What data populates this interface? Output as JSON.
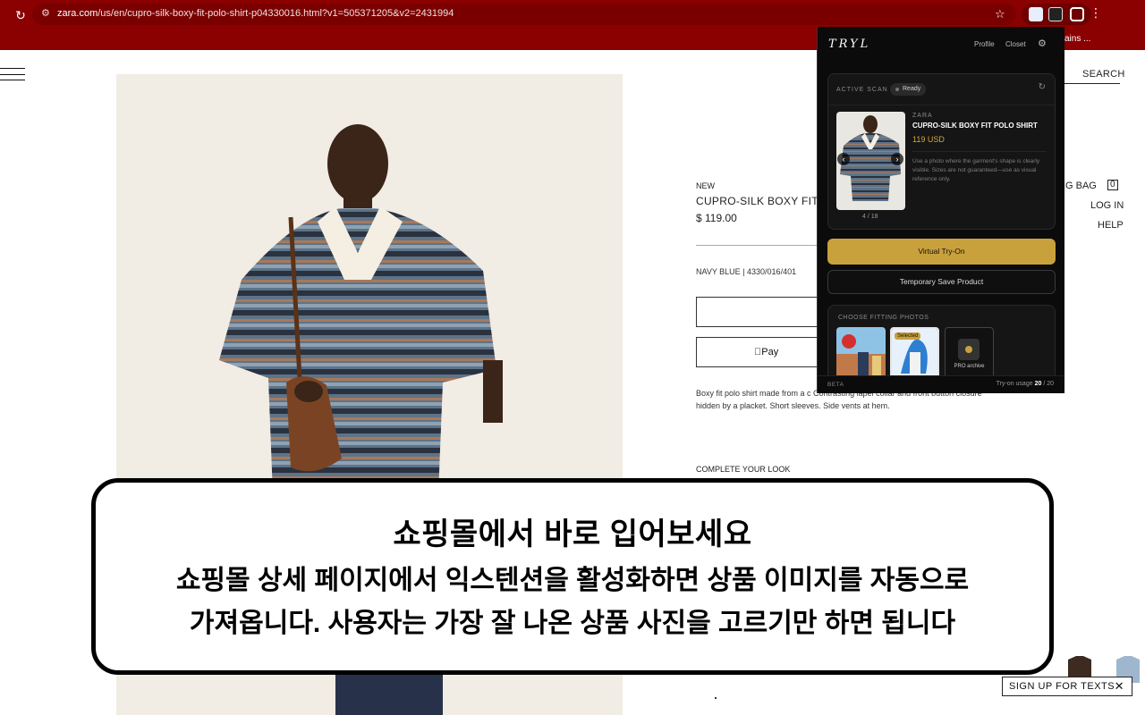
{
  "browser": {
    "url_host": "zara.com",
    "url_rest": "/us/en/cupro-silk-boxy-fit-polo-shirt-p04330016.html?v1=505371205&v2=2431994",
    "bookmark_text": "ains ..."
  },
  "zara": {
    "search_label": "SEARCH",
    "tag_new": "NEW",
    "product_name": "CUPRO-SILK BOXY FIT",
    "price": "$ 119.00",
    "color_ref": "NAVY BLUE | 4330/016/401",
    "apple_pay_label": "Pay",
    "description": "Boxy fit polo shirt made from a c Contrasting lapel collar and front button closure hidden by a placket. Short sleeves. Side vents at hem.",
    "complete_look": "COMPLETE YOUR LOOK",
    "shopping_bag": "ING BAG",
    "bag_count": "0",
    "login": "LOG IN",
    "help": "HELP",
    "signup": "SIGN UP FOR TEXTS"
  },
  "tryl": {
    "logo": "TRYL",
    "nav_profile": "Profile",
    "nav_closet": "Closet",
    "scan_label": "ACTIVE SCAN",
    "status": "Ready",
    "brand": "ZARA",
    "product_title": "CUPRO-SILK BOXY FIT POLO SHIRT",
    "price": "119 USD",
    "note": "Use a photo where the garment's shape is clearly visible. Sizes are not guaranteed—use as visual reference only.",
    "counter": "4 / 18",
    "tryon_label": "Virtual Try-On",
    "save_label": "Temporary Save Product",
    "fitting_label": "CHOOSE FITTING PHOTOS",
    "selected_badge": "Selected",
    "pro_label": "PRO archive",
    "beta": "BETA",
    "usage_label": "Try-on usage",
    "usage_used": "20",
    "usage_total": "/ 20"
  },
  "caption": {
    "title": "쇼핑몰에서 바로 입어보세요",
    "line1": "쇼핑몰 상세 페이지에서 익스텐션을 활성화하면 상품 이미지를 자동으로",
    "line2": "가져옵니다. 사용자는 가장 잘 나온 상품 사진을 고르기만 하면 됩니다"
  },
  "colors": {
    "chrome_bg": "#8b0000",
    "tryl_accent": "#c9a13c",
    "tryl_bg": "#0b0b0b"
  }
}
